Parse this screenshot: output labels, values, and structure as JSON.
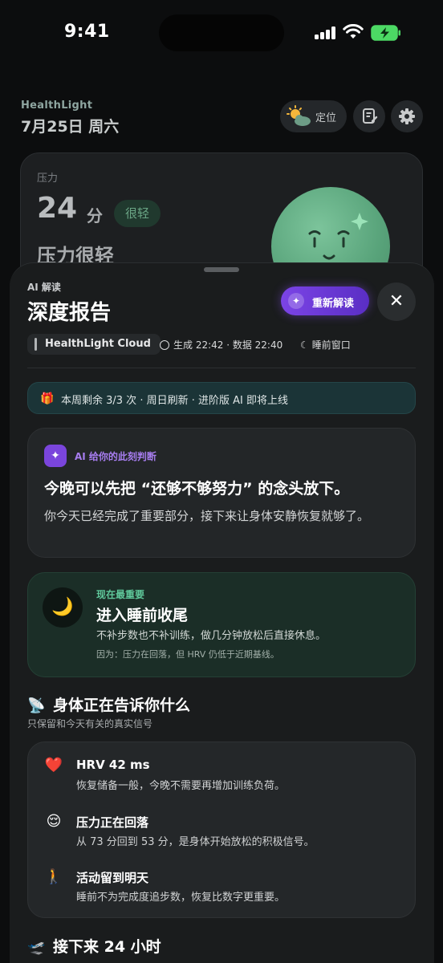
{
  "status_bar": {
    "time": "9:41"
  },
  "background": {
    "brand": "HealthLight",
    "date": "7月25日 周六",
    "location_label": "定位",
    "stress_card": {
      "label": "压力",
      "score": "24",
      "unit": "分",
      "level_chip": "很轻",
      "summary": "压力很轻"
    }
  },
  "sheet": {
    "eyebrow": "AI 解读",
    "title": "深度报告",
    "reread_label": "重新解读",
    "source": "HealthLight Cloud",
    "generated": "生成 22:42 · 数据 22:40",
    "window": "睡前窗口",
    "quota": "本周剩余 3/3 次 · 周日刷新 · 进阶版 AI 即将上线",
    "judgement": {
      "tag": "AI 给你的此刻判断",
      "headline": "今晚可以先把 “还够不够努力” 的念头放下。",
      "body": "你今天已经完成了重要部分，接下来让身体安静恢复就够了。"
    },
    "focus": {
      "tag": "现在最重要",
      "title": "进入睡前收尾",
      "desc": "不补步数也不补训练，做几分钟放松后直接休息。",
      "reason": "因为：压力在回落，但 HRV 仍低于近期基线。"
    },
    "signals_section": {
      "title": "身体正在告诉你什么",
      "subtitle": "只保留和今天有关的真实信号",
      "items": [
        {
          "icon": "heart-icon",
          "title": "HRV 42 ms",
          "desc": "恢复储备一般，今晚不需要再增加训练负荷。"
        },
        {
          "icon": "relieved-face-icon",
          "title": "压力正在回落",
          "desc": "从 73 分回到 53 分，是身体开始放松的积极信号。"
        },
        {
          "icon": "walking-person-icon",
          "title": "活动留到明天",
          "desc": "睡前不为完成度追步数，恢复比数字更重要。"
        }
      ]
    },
    "next_section": {
      "title": "接下来 24 小时"
    }
  },
  "colors": {
    "accent_purple": "#7b44e6",
    "focus_green": "#5fc79a",
    "sheet_bg": "#1a1c1d"
  }
}
